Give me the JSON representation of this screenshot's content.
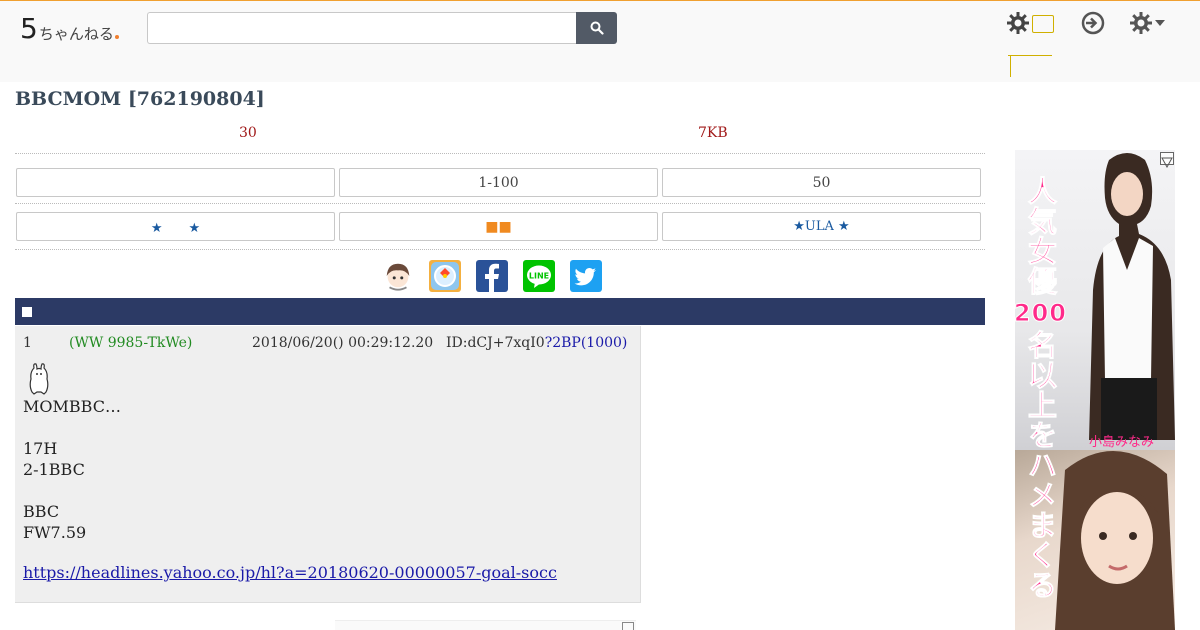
{
  "header": {
    "logo_five": "5",
    "logo_rest": "ちゃんねる",
    "search_value": "",
    "tiny_menu_label_1": "",
    "tiny_menu_label_2": ""
  },
  "thread": {
    "title": "BBCMOM [762190804]",
    "res_count": "30",
    "size": "7KB"
  },
  "nav_buttons": {
    "row1": [
      "",
      "1-100",
      "50"
    ],
    "row2": [
      "★　　★",
      "■■",
      "★ULA ★"
    ]
  },
  "share": {
    "icons": [
      "avatar-icon",
      "maps-icon",
      "facebook-icon",
      "line-icon",
      "twitter-icon"
    ],
    "line_label": "LINE"
  },
  "post": {
    "number": "1",
    "name": "(WW 9985-TkWe)",
    "date": "2018/06/20() 00:29:12.20",
    "id": "ID:dCJ+7xqI0",
    "be": "?2BP(1000)",
    "body": "MOMBBC…\n\n17H\n2-1BBC\n\nBBC\nFW7.59",
    "link": "https://headlines.yahoo.co.jp/hl?a=20180620-00000057-goal-socc"
  },
  "ad": {
    "text_top": "人気女優",
    "text_num": "200",
    "text_rest": "名以上をハメまくる♥",
    "name": "小島みなみ"
  },
  "colors": {
    "section_bar": "#2c3a65",
    "accent_red": "#a01818",
    "name_green": "#228b22",
    "link_blue": "#1a1aa8",
    "ad_pink": "#ff2a8a"
  }
}
